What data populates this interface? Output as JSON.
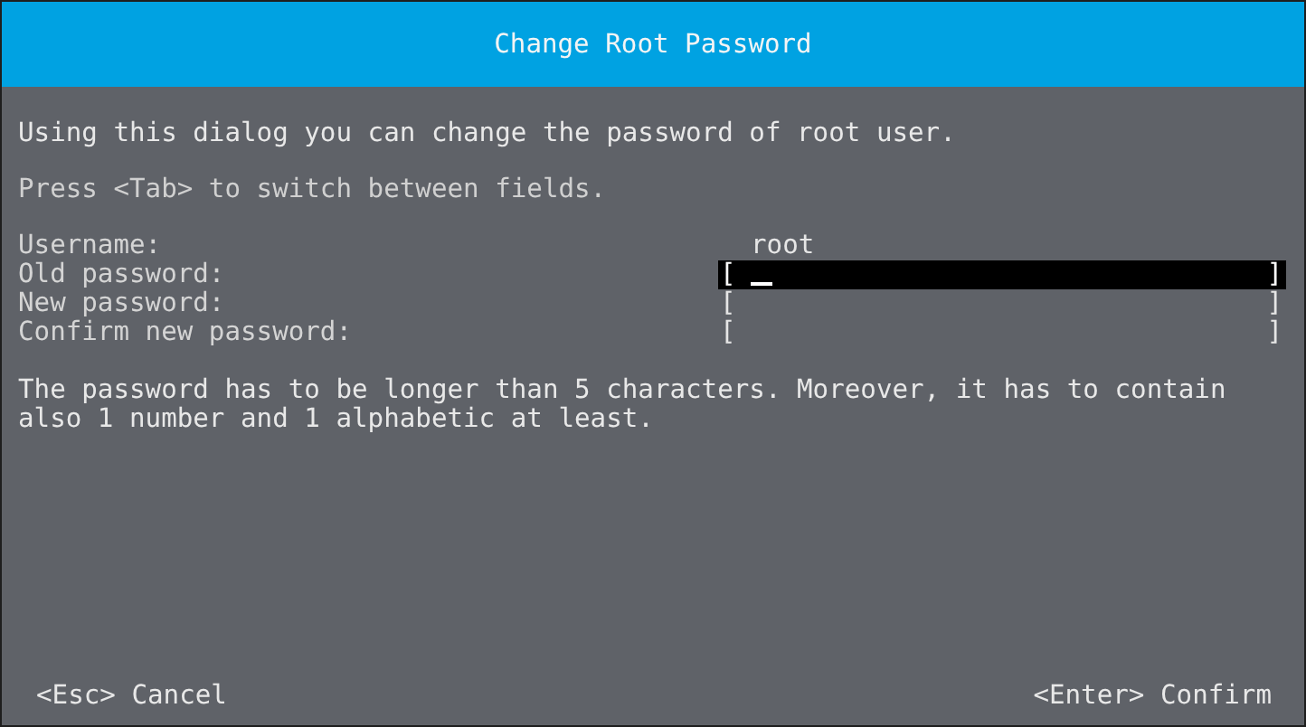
{
  "title": "Change Root Password",
  "intro": "Using this dialog you can change the password of root user.",
  "hint": "Press <Tab> to switch between fields.",
  "fields": [
    {
      "label": "Username:",
      "kind": "text",
      "value": "root"
    },
    {
      "label": "Old password:",
      "kind": "password",
      "open": "[",
      "close": "]",
      "focused": true
    },
    {
      "label": "New password:",
      "kind": "password",
      "open": "[",
      "close": "]",
      "focused": false
    },
    {
      "label": "Confirm new password:",
      "kind": "password",
      "open": "[",
      "close": "]",
      "focused": false
    }
  ],
  "note": "The password has to be longer than 5 characters. Moreover, it has to contain also 1 number and 1 alphabetic at least.",
  "footer": {
    "cancel": "<Esc> Cancel",
    "confirm": "<Enter> Confirm"
  }
}
